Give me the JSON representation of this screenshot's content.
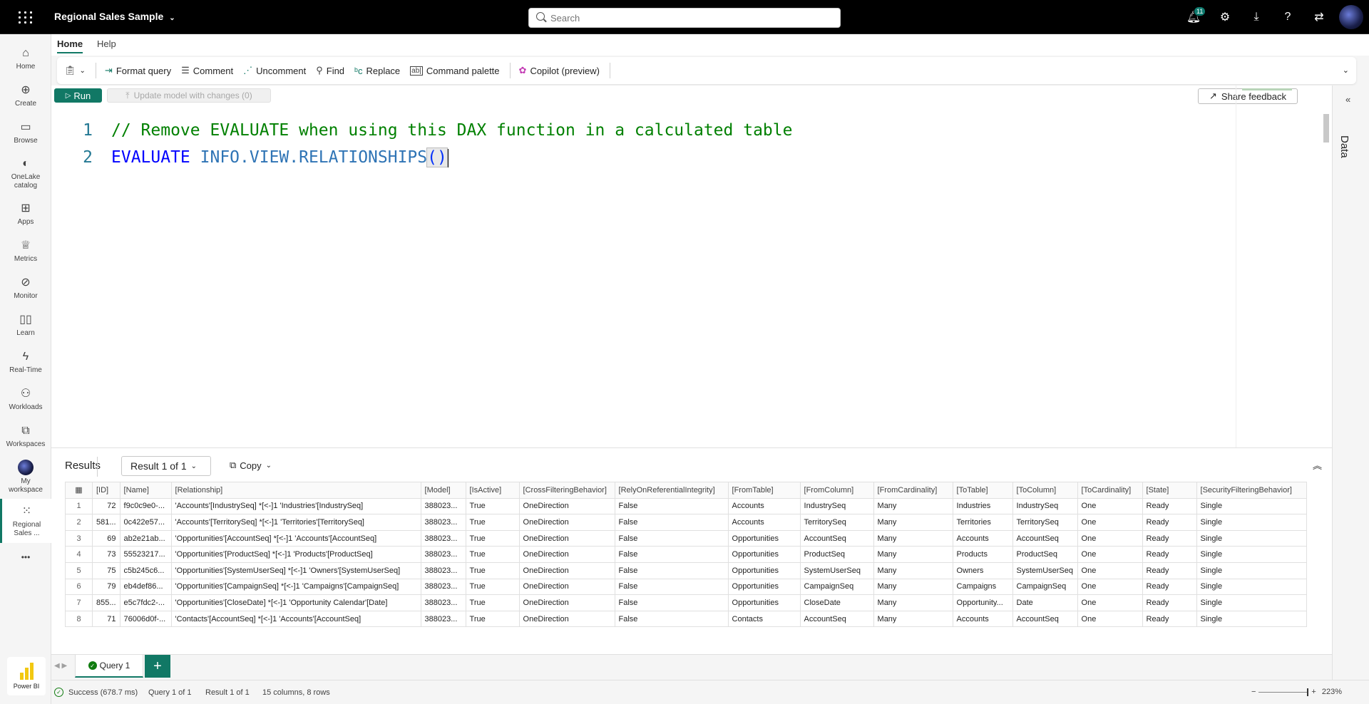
{
  "topbar": {
    "app_title": "Regional Sales Sample",
    "search_placeholder": "Search",
    "notification_count": "11"
  },
  "nav": {
    "items": [
      {
        "label": "Home",
        "icon": "⌂"
      },
      {
        "label": "Create",
        "icon": "⊕"
      },
      {
        "label": "Browse",
        "icon": "▭"
      },
      {
        "label": "OneLake catalog",
        "icon": "◐"
      },
      {
        "label": "Apps",
        "icon": "⊞"
      },
      {
        "label": "Metrics",
        "icon": "♕"
      },
      {
        "label": "Monitor",
        "icon": "⊘"
      },
      {
        "label": "Learn",
        "icon": "▯▯"
      },
      {
        "label": "Real-Time",
        "icon": "ϟ"
      },
      {
        "label": "Workloads",
        "icon": "⚇"
      },
      {
        "label": "Workspaces",
        "icon": "⧉"
      },
      {
        "label": "My workspace",
        "icon": ""
      },
      {
        "label": "Regional Sales ...",
        "icon": "⁙"
      }
    ],
    "more": "•••",
    "powerbi_label": "Power BI"
  },
  "ribbon_tabs": {
    "home": "Home",
    "help": "Help"
  },
  "ribbon": {
    "format_query": "Format query",
    "comment": "Comment",
    "uncomment": "Uncomment",
    "find": "Find",
    "replace": "Replace",
    "command_palette": "Command palette",
    "copilot": "Copilot (preview)"
  },
  "editor": {
    "run": "Run",
    "update_model": "Update model with changes (0)",
    "share_feedback": "Share feedback",
    "lines": [
      {
        "num": "1",
        "text": "// Remove EVALUATE when using this DAX function in a calculated table"
      },
      {
        "num": "2",
        "keyword": "EVALUATE",
        "func": "INFO.VIEW.RELATIONSHIPS",
        "paren": "()"
      }
    ]
  },
  "data_pane": {
    "label": "Data"
  },
  "results": {
    "title": "Results",
    "result_select": "Result 1 of 1",
    "copy": "Copy",
    "columns": [
      "[ID]",
      "[Name]",
      "[Relationship]",
      "[Model]",
      "[IsActive]",
      "[CrossFilteringBehavior]",
      "[RelyOnReferentialIntegrity]",
      "[FromTable]",
      "[FromColumn]",
      "[FromCardinality]",
      "[ToTable]",
      "[ToColumn]",
      "[ToCardinality]",
      "[State]",
      "[SecurityFilteringBehavior]"
    ],
    "rows": [
      [
        "1",
        "72",
        "f9c0c9e0-...",
        "'Accounts'[IndustrySeq] *[<-]1 'Industries'[IndustrySeq]",
        "388023...",
        "True",
        "OneDirection",
        "False",
        "Accounts",
        "IndustrySeq",
        "Many",
        "Industries",
        "IndustrySeq",
        "One",
        "Ready",
        "Single"
      ],
      [
        "2",
        "581...",
        "0c422e57...",
        "'Accounts'[TerritorySeq] *[<-]1 'Territories'[TerritorySeq]",
        "388023...",
        "True",
        "OneDirection",
        "False",
        "Accounts",
        "TerritorySeq",
        "Many",
        "Territories",
        "TerritorySeq",
        "One",
        "Ready",
        "Single"
      ],
      [
        "3",
        "69",
        "ab2e21ab...",
        "'Opportunities'[AccountSeq] *[<-]1 'Accounts'[AccountSeq]",
        "388023...",
        "True",
        "OneDirection",
        "False",
        "Opportunities",
        "AccountSeq",
        "Many",
        "Accounts",
        "AccountSeq",
        "One",
        "Ready",
        "Single"
      ],
      [
        "4",
        "73",
        "55523217...",
        "'Opportunities'[ProductSeq] *[<-]1 'Products'[ProductSeq]",
        "388023...",
        "True",
        "OneDirection",
        "False",
        "Opportunities",
        "ProductSeq",
        "Many",
        "Products",
        "ProductSeq",
        "One",
        "Ready",
        "Single"
      ],
      [
        "5",
        "75",
        "c5b245c6...",
        "'Opportunities'[SystemUserSeq] *[<-]1 'Owners'[SystemUserSeq]",
        "388023...",
        "True",
        "OneDirection",
        "False",
        "Opportunities",
        "SystemUserSeq",
        "Many",
        "Owners",
        "SystemUserSeq",
        "One",
        "Ready",
        "Single"
      ],
      [
        "6",
        "79",
        "eb4def86...",
        "'Opportunities'[CampaignSeq] *[<-]1 'Campaigns'[CampaignSeq]",
        "388023...",
        "True",
        "OneDirection",
        "False",
        "Opportunities",
        "CampaignSeq",
        "Many",
        "Campaigns",
        "CampaignSeq",
        "One",
        "Ready",
        "Single"
      ],
      [
        "7",
        "855...",
        "e5c7fdc2-...",
        "'Opportunities'[CloseDate] *[<-]1 'Opportunity Calendar'[Date]",
        "388023...",
        "True",
        "OneDirection",
        "False",
        "Opportunities",
        "CloseDate",
        "Many",
        "Opportunity...",
        "Date",
        "One",
        "Ready",
        "Single"
      ],
      [
        "8",
        "71",
        "76006d0f-...",
        "'Contacts'[AccountSeq] *[<-]1 'Accounts'[AccountSeq]",
        "388023...",
        "True",
        "OneDirection",
        "False",
        "Contacts",
        "AccountSeq",
        "Many",
        "Accounts",
        "AccountSeq",
        "One",
        "Ready",
        "Single"
      ]
    ]
  },
  "query_tabs": {
    "tab": "Query 1",
    "add": "+"
  },
  "status": {
    "success": "Success (678.7 ms)",
    "query": "Query 1 of 1",
    "result": "Result 1 of 1",
    "shape": "15 columns, 8 rows",
    "zoom": "223%"
  }
}
